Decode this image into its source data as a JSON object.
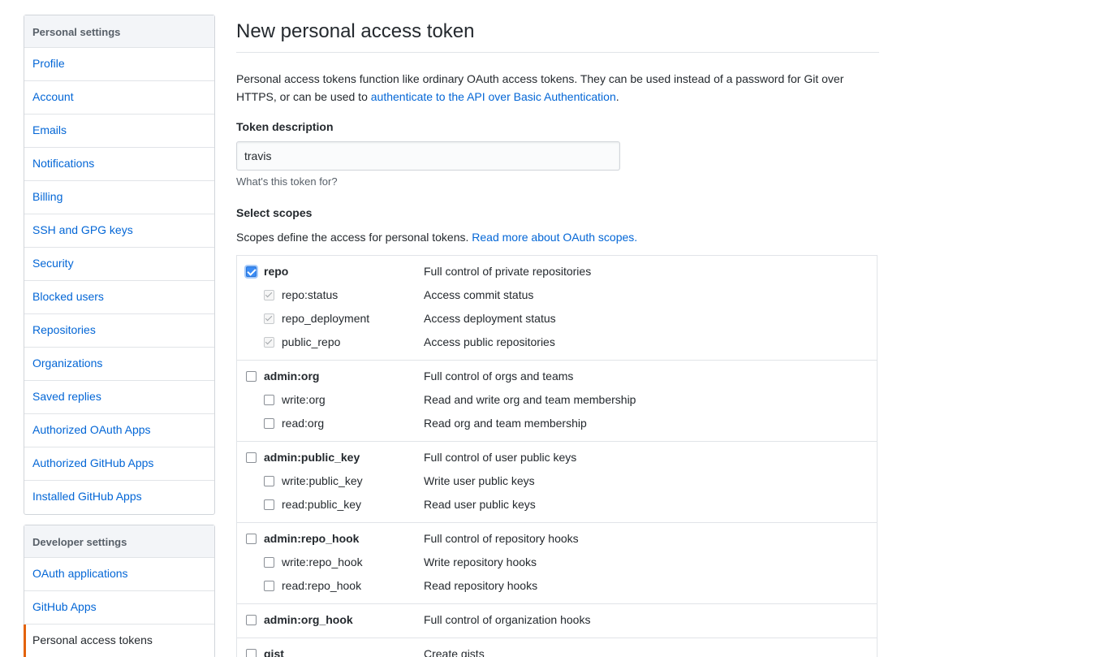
{
  "sidebar": {
    "personal_heading": "Personal settings",
    "personal_items": [
      "Profile",
      "Account",
      "Emails",
      "Notifications",
      "Billing",
      "SSH and GPG keys",
      "Security",
      "Blocked users",
      "Repositories",
      "Organizations",
      "Saved replies",
      "Authorized OAuth Apps",
      "Authorized GitHub Apps",
      "Installed GitHub Apps"
    ],
    "developer_heading": "Developer settings",
    "developer_items": [
      "OAuth applications",
      "GitHub Apps",
      "Personal access tokens"
    ],
    "selected": "Personal access tokens"
  },
  "main": {
    "title": "New personal access token",
    "intro_text": "Personal access tokens function like ordinary OAuth access tokens. They can be used instead of a password for Git over HTTPS, or can be used to ",
    "intro_link": "authenticate to the API over Basic Authentication",
    "intro_end": ".",
    "token_label": "Token description",
    "token_value": "travis",
    "token_note": "What's this token for?",
    "scopes_label": "Select scopes",
    "scopes_text": "Scopes define the access for personal tokens. ",
    "scopes_link": "Read more about OAuth scopes."
  },
  "scopes": [
    {
      "name": "repo",
      "desc": "Full control of private repositories",
      "checked": true,
      "children": [
        {
          "name": "repo:status",
          "desc": "Access commit status",
          "checked": true
        },
        {
          "name": "repo_deployment",
          "desc": "Access deployment status",
          "checked": true
        },
        {
          "name": "public_repo",
          "desc": "Access public repositories",
          "checked": true
        }
      ]
    },
    {
      "name": "admin:org",
      "desc": "Full control of orgs and teams",
      "checked": false,
      "children": [
        {
          "name": "write:org",
          "desc": "Read and write org and team membership",
          "checked": false
        },
        {
          "name": "read:org",
          "desc": "Read org and team membership",
          "checked": false
        }
      ]
    },
    {
      "name": "admin:public_key",
      "desc": "Full control of user public keys",
      "checked": false,
      "children": [
        {
          "name": "write:public_key",
          "desc": "Write user public keys",
          "checked": false
        },
        {
          "name": "read:public_key",
          "desc": "Read user public keys",
          "checked": false
        }
      ]
    },
    {
      "name": "admin:repo_hook",
      "desc": "Full control of repository hooks",
      "checked": false,
      "children": [
        {
          "name": "write:repo_hook",
          "desc": "Write repository hooks",
          "checked": false
        },
        {
          "name": "read:repo_hook",
          "desc": "Read repository hooks",
          "checked": false
        }
      ]
    },
    {
      "name": "admin:org_hook",
      "desc": "Full control of organization hooks",
      "checked": false,
      "children": []
    },
    {
      "name": "gist",
      "desc": "Create gists",
      "checked": false,
      "children": []
    }
  ]
}
